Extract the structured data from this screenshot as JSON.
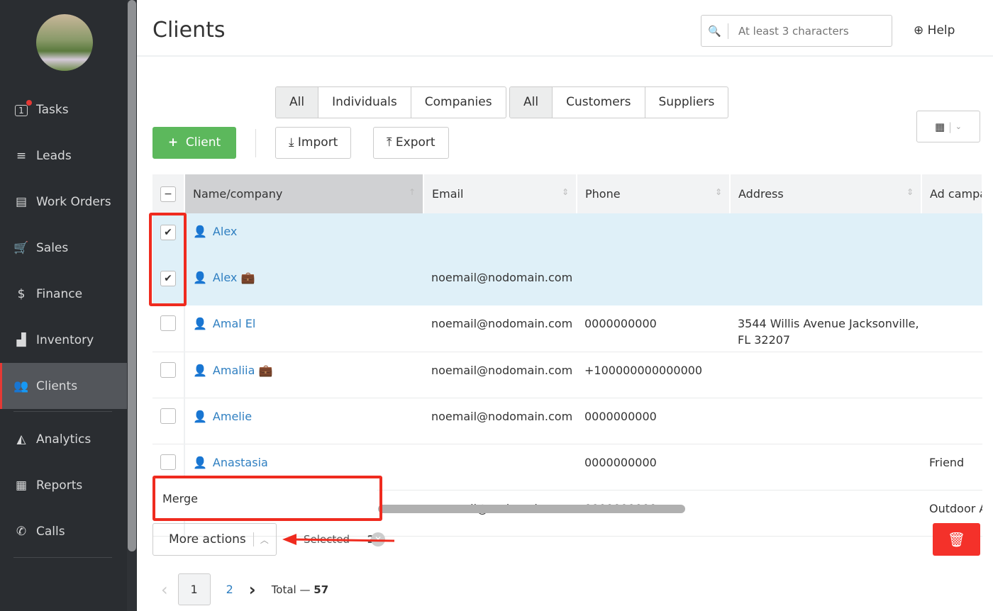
{
  "sidebar": {
    "items": [
      {
        "label": "Tasks",
        "icon": "tasks-icon",
        "badge": "1"
      },
      {
        "label": "Leads",
        "icon": "funnel-icon"
      },
      {
        "label": "Work Orders",
        "icon": "work-orders-icon"
      },
      {
        "label": "Sales",
        "icon": "cart-icon"
      },
      {
        "label": "Finance",
        "icon": "dollar-icon"
      },
      {
        "label": "Inventory",
        "icon": "boxes-icon"
      },
      {
        "label": "Clients",
        "icon": "users-icon",
        "active": true
      },
      {
        "label": "Analytics",
        "icon": "chart-icon"
      },
      {
        "label": "Reports",
        "icon": "reports-icon"
      },
      {
        "label": "Calls",
        "icon": "phone-icon"
      }
    ]
  },
  "header": {
    "title": "Clients",
    "search_placeholder": "At least 3 characters",
    "help": "Help"
  },
  "filters": {
    "type": [
      "All",
      "Individuals",
      "Companies"
    ],
    "relation": [
      "All",
      "Customers",
      "Suppliers"
    ]
  },
  "toolbar": {
    "add": "Client",
    "import": "Import",
    "export": "Export"
  },
  "table": {
    "columns": [
      "Name/company",
      "Email",
      "Phone",
      "Address",
      "Ad campa"
    ],
    "rows": [
      {
        "name": "Alex",
        "company": false,
        "email": "",
        "phone": "",
        "address": "",
        "ad": "",
        "checked": true
      },
      {
        "name": "Alex",
        "company": true,
        "email": "noemail@nodomain.com",
        "phone": "",
        "address": "",
        "ad": "",
        "checked": true
      },
      {
        "name": "Amal El",
        "company": false,
        "email": "noemail@nodomain.com",
        "phone": "0000000000",
        "address": "3544 Willis Avenue Jacksonville, FL 32207",
        "ad": "",
        "checked": false
      },
      {
        "name": "Amaliia",
        "company": true,
        "email": "noemail@nodomain.com",
        "phone": "+100000000000000",
        "address": "",
        "ad": "",
        "checked": false
      },
      {
        "name": "Amelie",
        "company": false,
        "email": "noemail@nodomain.com",
        "phone": "0000000000",
        "address": "",
        "ad": "",
        "checked": false
      },
      {
        "name": "Anastasia",
        "company": false,
        "email": "",
        "phone": "0000000000",
        "address": "",
        "ad": "Friend",
        "checked": false
      },
      {
        "name": "",
        "company": false,
        "email": "noemail@nodomain.com",
        "phone": "0000000000",
        "address": "",
        "ad": "Outdoor A",
        "checked": false
      }
    ]
  },
  "actions": {
    "menu_item": "Merge",
    "more": "More actions",
    "selected_label": "Selected —",
    "selected_count": "2"
  },
  "pager": {
    "pages": [
      "1",
      "2"
    ],
    "current": "1",
    "total_label": "Total —",
    "total": "57"
  },
  "colors": {
    "accent": "#5cb85c",
    "danger": "#f4312a",
    "highlight": "#ef2b1f",
    "link": "#2f7fc1"
  }
}
